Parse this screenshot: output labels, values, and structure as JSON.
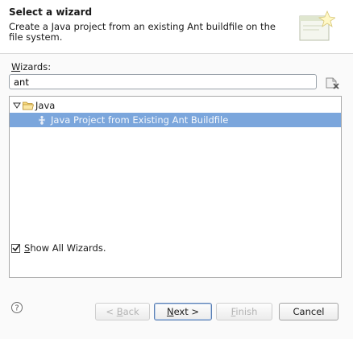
{
  "header": {
    "title": "Select a wizard",
    "description": "Create a Java project from an existing Ant buildfile on the file system.",
    "image_icon": "wizard-banner-icon"
  },
  "wizards": {
    "label_mnemonic": "W",
    "label_rest": "izards:",
    "filter_value": "ant",
    "clear_icon": "clear-filter-icon"
  },
  "tree": {
    "items": [
      {
        "label": "Java",
        "icon": "folder-icon",
        "expanded": true
      },
      {
        "label": "Java Project from Existing Ant Buildfile",
        "icon": "ant-icon",
        "selected": true
      }
    ]
  },
  "show_all": {
    "checked": true,
    "mnemonic": "S",
    "rest": "how All Wizards."
  },
  "buttons": {
    "back_prefix": "< ",
    "back_mnemonic": "B",
    "back_rest": "ack",
    "next_mnemonic": "N",
    "next_rest": "ext >",
    "finish_mnemonic": "F",
    "finish_rest": "inish",
    "cancel": "Cancel"
  },
  "colors": {
    "selection": "#7ba6dc",
    "default_button_border": "#5a7fb5"
  }
}
